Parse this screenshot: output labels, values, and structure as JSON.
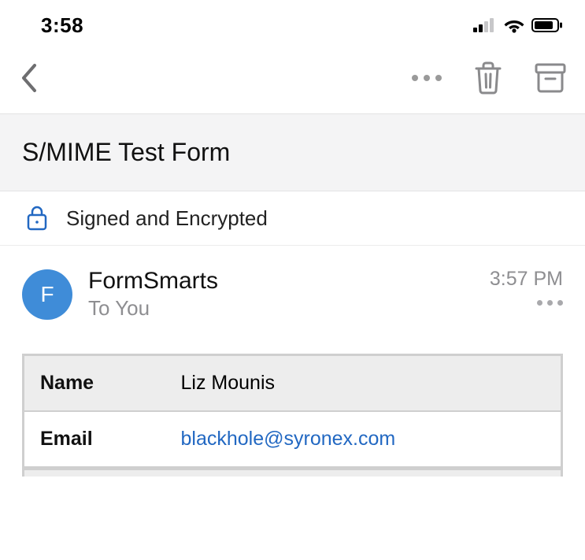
{
  "status": {
    "time": "3:58"
  },
  "subject": "S/MIME Test Form",
  "security": {
    "label": "Signed and Encrypted"
  },
  "message": {
    "sender": "FormSmarts",
    "to_line": "To You",
    "avatar_initial": "F",
    "time": "3:57 PM"
  },
  "table": {
    "name_label": "Name",
    "name_value": "Liz Mounis",
    "email_label": "Email",
    "email_value": "blackhole@syronex.com"
  },
  "colors": {
    "accent": "#3f8cd8",
    "link": "#2268c2"
  }
}
